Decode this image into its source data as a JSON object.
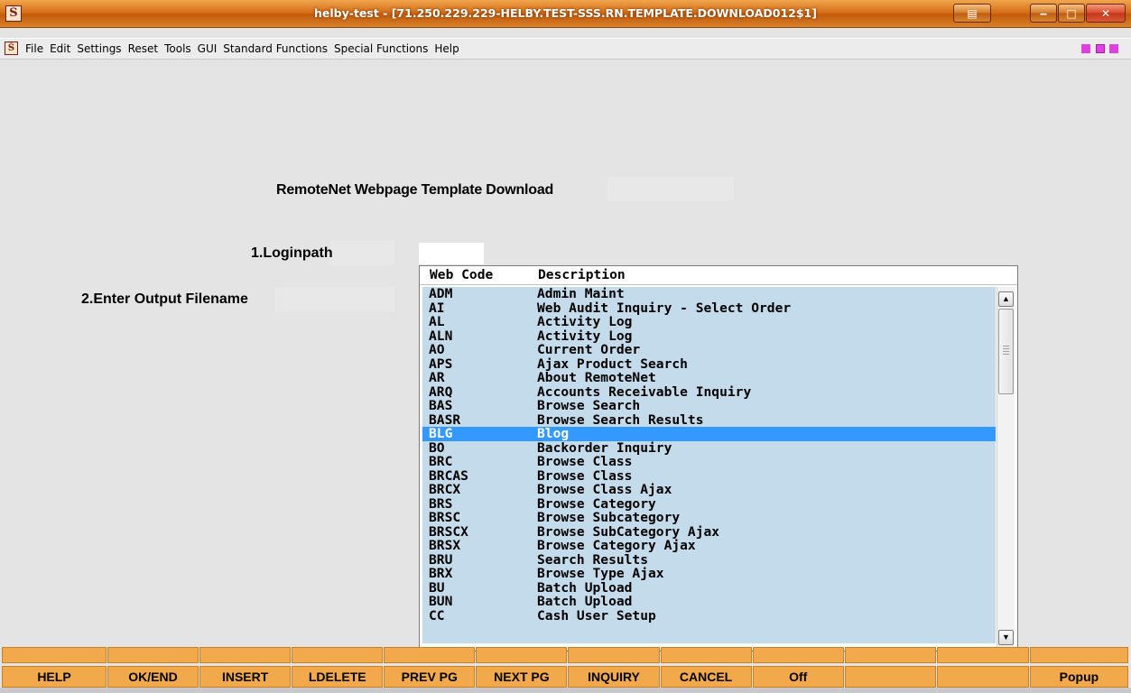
{
  "window": {
    "icon_glyph": "Š",
    "title": "helby-test - [71.250.229.229-HELBY.TEST-SSS.RN.TEMPLATE.DOWNLOAD012$1]",
    "buttons": {
      "minimize": "‒",
      "maximize": "□",
      "close": "✕",
      "extra": "▤"
    }
  },
  "menubar": {
    "items": [
      "File",
      "Edit",
      "Settings",
      "Reset",
      "Tools",
      "GUI",
      "Standard Functions",
      "Special Functions",
      "Help"
    ]
  },
  "form": {
    "title": "RemoteNet Webpage Template Download",
    "fields": [
      {
        "label": "1.Loginpath",
        "value": ""
      },
      {
        "label": "2.Enter Output Filename",
        "value": ""
      }
    ]
  },
  "lookup": {
    "headers": {
      "code": "Web Code",
      "description": "Description"
    },
    "selected_index": 10,
    "rows": [
      {
        "code": "ADM",
        "description": "Admin Maint"
      },
      {
        "code": "AI",
        "description": "Web Audit Inquiry - Select Order"
      },
      {
        "code": "AL",
        "description": "Activity Log"
      },
      {
        "code": "ALN",
        "description": "Activity Log"
      },
      {
        "code": "AO",
        "description": "Current Order"
      },
      {
        "code": "APS",
        "description": "Ajax Product Search"
      },
      {
        "code": "AR",
        "description": "About RemoteNet"
      },
      {
        "code": "ARQ",
        "description": "Accounts Receivable Inquiry"
      },
      {
        "code": "BAS",
        "description": "Browse Search"
      },
      {
        "code": "BASR",
        "description": "Browse Search Results"
      },
      {
        "code": "BLG",
        "description": "Blog"
      },
      {
        "code": "BO",
        "description": "Backorder Inquiry"
      },
      {
        "code": "BRC",
        "description": "Browse Class"
      },
      {
        "code": "BRCAS",
        "description": "Browse Class"
      },
      {
        "code": "BRCX",
        "description": "Browse Class Ajax"
      },
      {
        "code": "BRS",
        "description": "Browse Category"
      },
      {
        "code": "BRSC",
        "description": "Browse Subcategory"
      },
      {
        "code": "BRSCX",
        "description": "Browse SubCategory Ajax"
      },
      {
        "code": "BRSX",
        "description": "Browse Category Ajax"
      },
      {
        "code": "BRU",
        "description": "Search Results"
      },
      {
        "code": "BRX",
        "description": "Browse Type Ajax"
      },
      {
        "code": "BU",
        "description": "Batch Upload"
      },
      {
        "code": "BUN",
        "description": "Batch Upload"
      },
      {
        "code": "CC",
        "description": "Cash User Setup"
      }
    ],
    "scroll": {
      "up_arrow": "▲",
      "down_arrow": "▼"
    }
  },
  "function_keys": {
    "top_row": [
      "",
      "",
      "",
      "",
      "",
      "",
      "",
      "",
      "",
      "",
      "",
      ""
    ],
    "bottom_row": [
      "HELP",
      "OK/END",
      "INSERT",
      "LDELETE",
      "PREV PG",
      "NEXT PG",
      "INQUIRY",
      "CANCEL",
      "Off",
      "",
      "",
      "Popup"
    ]
  },
  "colors": {
    "title_bar": "#d6701a",
    "function_key": "#f2a94c",
    "list_background": "#c3dbeb",
    "selected_row": "#3399ff"
  }
}
